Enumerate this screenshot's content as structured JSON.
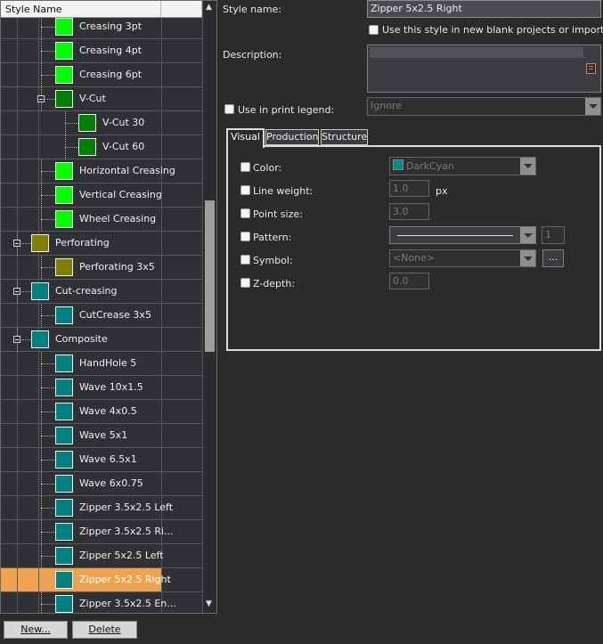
{
  "tree": {
    "header": "Style Name",
    "rows": [
      {
        "label": "Creasing 3pt",
        "color": "#00ff00",
        "level": 2
      },
      {
        "label": "Creasing 4pt",
        "color": "#00ff00",
        "level": 2
      },
      {
        "label": "Creasing 6pt",
        "color": "#00ff00",
        "level": 2
      },
      {
        "label": "V-Cut",
        "color": "#008000",
        "level": 2,
        "expander": true
      },
      {
        "label": "V-Cut 30",
        "color": "#008000",
        "level": 3
      },
      {
        "label": "V-Cut 60",
        "color": "#008000",
        "level": 3
      },
      {
        "label": "Horizontal Creasing",
        "color": "#00ff00",
        "level": 2
      },
      {
        "label": "Vertical Creasing",
        "color": "#00ff00",
        "level": 2
      },
      {
        "label": "Wheel Creasing",
        "color": "#00ff00",
        "level": 2
      },
      {
        "label": "Perforating",
        "color": "#808000",
        "level": 1,
        "expander": true
      },
      {
        "label": "Perforating 3x5",
        "color": "#808000",
        "level": 2
      },
      {
        "label": "Cut-creasing",
        "color": "#008080",
        "level": 1,
        "expander": true
      },
      {
        "label": "CutCrease 3x5",
        "color": "#008080",
        "level": 2
      },
      {
        "label": "Composite",
        "color": "#008080",
        "level": 1,
        "expander": true
      },
      {
        "label": "HandHole 5",
        "color": "#008080",
        "level": 2
      },
      {
        "label": "Wave 10x1.5",
        "color": "#008080",
        "level": 2
      },
      {
        "label": "Wave 4x0.5",
        "color": "#008080",
        "level": 2
      },
      {
        "label": "Wave 5x1",
        "color": "#008080",
        "level": 2
      },
      {
        "label": "Wave 6.5x1",
        "color": "#008080",
        "level": 2
      },
      {
        "label": "Wave 6x0.75",
        "color": "#008080",
        "level": 2
      },
      {
        "label": "Zipper 3.5x2.5 Left",
        "color": "#008080",
        "level": 2
      },
      {
        "label": "Zipper 3.5x2.5 Ri...",
        "color": "#008080",
        "level": 2
      },
      {
        "label": "Zipper 5x2.5 Left",
        "color": "#008080",
        "level": 2
      },
      {
        "label": "Zipper 5x2.5 Right",
        "color": "#008080",
        "level": 2,
        "selected": true
      },
      {
        "label": "Zipper 3.5x2.5 En...",
        "color": "#008080",
        "level": 2
      }
    ]
  },
  "buttons": {
    "new": "New...",
    "delete": "Delete"
  },
  "form": {
    "style_name_label": "Style name:",
    "style_name_value": "Zipper 5x2.5 Right",
    "use_in_new_label": "Use this style in new blank projects or imports",
    "description_label": "Description:",
    "description_value": "",
    "print_legend_label": "Use in print legend:",
    "print_legend_value": "Ignore"
  },
  "tabs": [
    "Visual",
    "Production",
    "Structure"
  ],
  "visual": {
    "color_label": "Color:",
    "color_value": "DarkCyan",
    "color_swatch": "#008b8b",
    "line_weight_label": "Line weight:",
    "line_weight_value": "1.0",
    "line_weight_unit": "px",
    "point_size_label": "Point size:",
    "point_size_value": "3.0",
    "pattern_label": "Pattern:",
    "pattern_count": "1",
    "symbol_label": "Symbol:",
    "symbol_value": "<None>",
    "symbol_button": "...",
    "zdepth_label": "Z-depth:",
    "zdepth_value": "0.0"
  }
}
